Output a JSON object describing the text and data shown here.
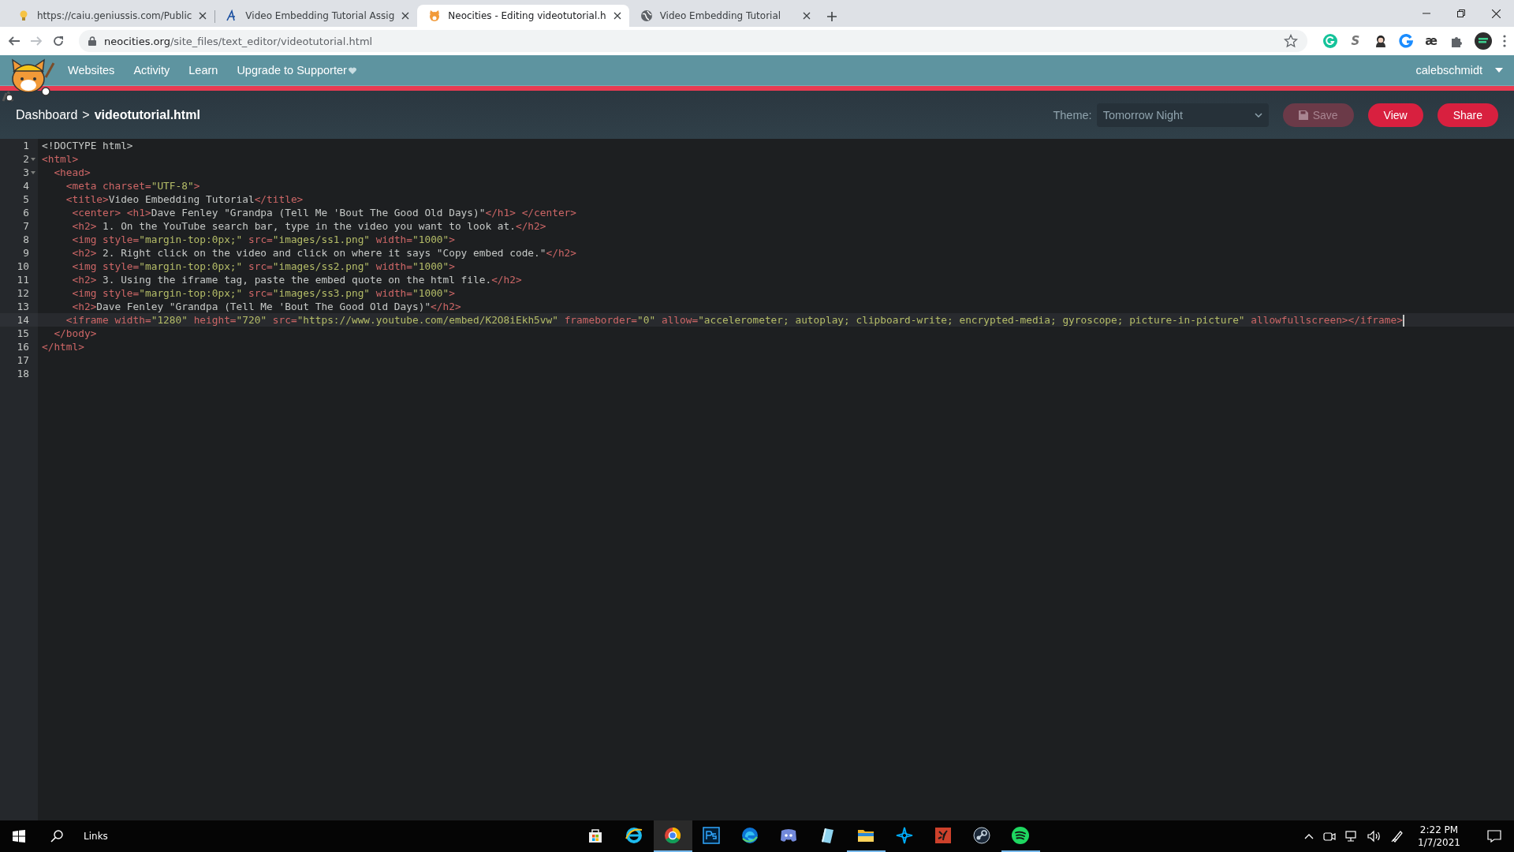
{
  "browser": {
    "tabs": [
      {
        "title": "https://caiu.geniussis.com/Public",
        "selected": false
      },
      {
        "title": "Video Embedding Tutorial Assig",
        "selected": false
      },
      {
        "title": "Neocities - Editing videotutorial.h",
        "selected": true
      },
      {
        "title": "Video Embedding Tutorial",
        "selected": false
      }
    ],
    "address": {
      "host": "neocities.org",
      "path": "/site_files/text_editor/videotutorial.html"
    },
    "extension_texts": [
      "S",
      "æ"
    ]
  },
  "site_nav": {
    "items": [
      "Websites",
      "Activity",
      "Learn",
      "Upgrade to Supporter"
    ],
    "user": "calebschmidt"
  },
  "editor_header": {
    "breadcrumb": {
      "link": "Dashboard",
      "separator": ">",
      "current": "videotutorial.html"
    },
    "theme": {
      "label": "Theme:",
      "value": "Tomorrow Night"
    },
    "buttons": [
      {
        "label": "Save",
        "disabled": true
      },
      {
        "label": "View",
        "disabled": false
      },
      {
        "label": "Share",
        "disabled": false
      }
    ]
  },
  "editor": {
    "lines": [
      {
        "number": "1",
        "fold": false,
        "active": false,
        "tokens": [
          {
            "kind": "text",
            "text": "<!DOCTYPE html>"
          }
        ]
      },
      {
        "number": "2",
        "fold": true,
        "active": false,
        "tokens": [
          {
            "kind": "tag",
            "text": "<html>"
          }
        ]
      },
      {
        "number": "3",
        "fold": true,
        "active": false,
        "tokens": [
          {
            "kind": "tag",
            "text": "  <head>"
          }
        ]
      },
      {
        "number": "4",
        "fold": false,
        "active": false,
        "tokens": [
          {
            "kind": "tag",
            "text": "    <meta charset="
          },
          {
            "kind": "string",
            "text": "\"UTF-8\""
          },
          {
            "kind": "tag",
            "text": ">"
          }
        ]
      },
      {
        "number": "5",
        "fold": false,
        "active": false,
        "tokens": [
          {
            "kind": "tag",
            "text": "    <title>"
          },
          {
            "kind": "text",
            "text": "Video Embedding Tutorial"
          },
          {
            "kind": "tag",
            "text": "</title>"
          }
        ]
      },
      {
        "number": "6",
        "fold": false,
        "active": false,
        "tokens": [
          {
            "kind": "tag",
            "text": "     <center> <h1>"
          },
          {
            "kind": "text",
            "text": "Dave Fenley \"Grandpa (Tell Me 'Bout The Good Old Days)\""
          },
          {
            "kind": "tag",
            "text": "</h1> </center>"
          }
        ]
      },
      {
        "number": "7",
        "fold": false,
        "active": false,
        "tokens": [
          {
            "kind": "tag",
            "text": "     <h2>"
          },
          {
            "kind": "text",
            "text": " 1. On the YouTube search bar, type in the video you want to look at."
          },
          {
            "kind": "tag",
            "text": "</h2>"
          }
        ]
      },
      {
        "number": "8",
        "fold": false,
        "active": false,
        "tokens": [
          {
            "kind": "tag",
            "text": "     <img style="
          },
          {
            "kind": "string",
            "text": "\"margin-top:0px;\""
          },
          {
            "kind": "tag",
            "text": " src="
          },
          {
            "kind": "string",
            "text": "\"images/ss1.png\""
          },
          {
            "kind": "tag",
            "text": " width="
          },
          {
            "kind": "string",
            "text": "\"1000\""
          },
          {
            "kind": "tag",
            "text": ">"
          }
        ]
      },
      {
        "number": "9",
        "fold": false,
        "active": false,
        "tokens": [
          {
            "kind": "tag",
            "text": "     <h2>"
          },
          {
            "kind": "text",
            "text": " 2. Right click on the video and click on where it says \"Copy embed code.\""
          },
          {
            "kind": "tag",
            "text": "</h2>"
          }
        ]
      },
      {
        "number": "10",
        "fold": false,
        "active": false,
        "tokens": [
          {
            "kind": "tag",
            "text": "     <img style="
          },
          {
            "kind": "string",
            "text": "\"margin-top:0px;\""
          },
          {
            "kind": "tag",
            "text": " src="
          },
          {
            "kind": "string",
            "text": "\"images/ss2.png\""
          },
          {
            "kind": "tag",
            "text": " width="
          },
          {
            "kind": "string",
            "text": "\"1000\""
          },
          {
            "kind": "tag",
            "text": ">"
          }
        ]
      },
      {
        "number": "11",
        "fold": false,
        "active": false,
        "tokens": [
          {
            "kind": "tag",
            "text": "     <h2>"
          },
          {
            "kind": "text",
            "text": " 3. Using the iframe tag, paste the embed quote on the html file."
          },
          {
            "kind": "tag",
            "text": "</h2>"
          }
        ]
      },
      {
        "number": "12",
        "fold": false,
        "active": false,
        "tokens": [
          {
            "kind": "tag",
            "text": "     <img style="
          },
          {
            "kind": "string",
            "text": "\"margin-top:0px;\""
          },
          {
            "kind": "tag",
            "text": " src="
          },
          {
            "kind": "string",
            "text": "\"images/ss3.png\""
          },
          {
            "kind": "tag",
            "text": " width="
          },
          {
            "kind": "string",
            "text": "\"1000\""
          },
          {
            "kind": "tag",
            "text": ">"
          }
        ]
      },
      {
        "number": "13",
        "fold": false,
        "active": false,
        "tokens": [
          {
            "kind": "tag",
            "text": "     <h2>"
          },
          {
            "kind": "text",
            "text": "Dave Fenley \"Grandpa (Tell Me 'Bout The Good Old Days)\""
          },
          {
            "kind": "tag",
            "text": "</h2>"
          }
        ]
      },
      {
        "number": "14",
        "fold": false,
        "active": true,
        "tokens": [
          {
            "kind": "tag",
            "text": "    <iframe width="
          },
          {
            "kind": "string",
            "text": "\"1280\""
          },
          {
            "kind": "tag",
            "text": " height="
          },
          {
            "kind": "string",
            "text": "\"720\""
          },
          {
            "kind": "tag",
            "text": " src="
          },
          {
            "kind": "string",
            "text": "\"https://www.youtube.com/embed/K2O8iEkh5vw\""
          },
          {
            "kind": "tag",
            "text": " frameborder="
          },
          {
            "kind": "string",
            "text": "\"0\""
          },
          {
            "kind": "tag",
            "text": " allow="
          },
          {
            "kind": "string",
            "text": "\"accelerometer; autoplay; clipboard-write; encrypted-media; gyroscope; picture-in-picture\""
          },
          {
            "kind": "tag",
            "text": " allowfullscreen></iframe>"
          }
        ]
      },
      {
        "number": "15",
        "fold": false,
        "active": false,
        "tokens": [
          {
            "kind": "tag",
            "text": "  </body>"
          }
        ]
      },
      {
        "number": "16",
        "fold": false,
        "active": false,
        "tokens": [
          {
            "kind": "tag",
            "text": "</html>"
          }
        ]
      },
      {
        "number": "17",
        "fold": false,
        "active": false
      },
      {
        "number": "18",
        "fold": false,
        "active": false
      }
    ]
  },
  "taskbar": {
    "toolbar_label": "Links",
    "apps": [
      {
        "running": false,
        "selected": false
      },
      {
        "running": false,
        "selected": false
      },
      {
        "running": true,
        "selected": true
      },
      {
        "running": false,
        "selected": false
      },
      {
        "running": false,
        "selected": false
      },
      {
        "running": false,
        "selected": false
      },
      {
        "running": false,
        "selected": false
      },
      {
        "running": true,
        "selected": false
      },
      {
        "running": false,
        "selected": false
      },
      {
        "running": false,
        "selected": false
      },
      {
        "running": false,
        "selected": false
      },
      {
        "running": true,
        "selected": false
      }
    ],
    "time": "2:22 PM",
    "date": "1/7/2021"
  }
}
